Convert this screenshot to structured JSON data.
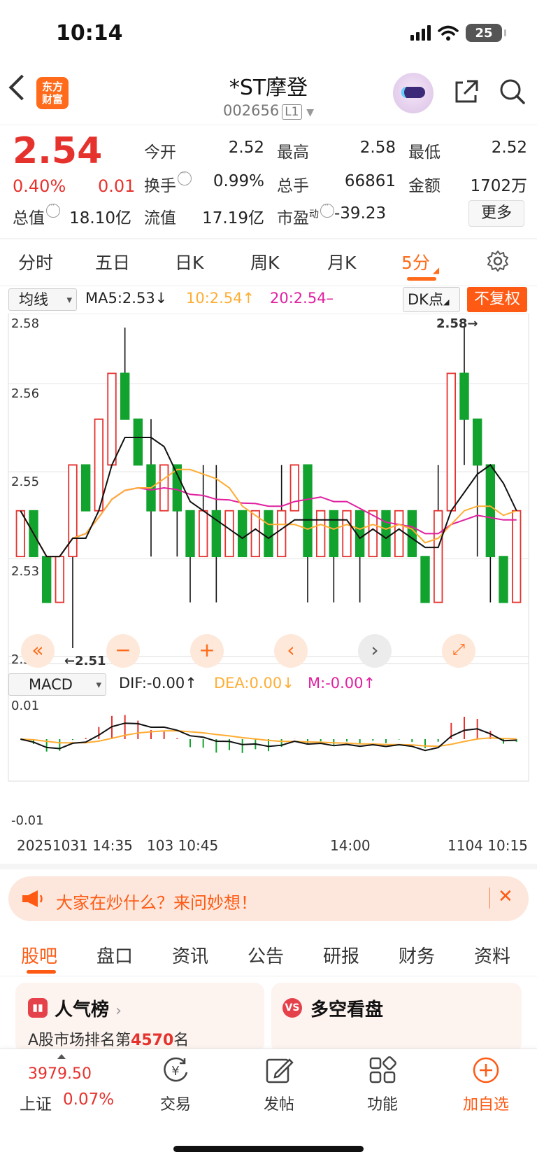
{
  "status": {
    "time": "10:14",
    "battery": "25"
  },
  "header": {
    "logo_line1": "东方",
    "logo_line2": "财富",
    "title": "*ST摩登",
    "code": "002656",
    "level": "L1"
  },
  "quote": {
    "price": "2.54",
    "pct": "0.40%",
    "chg": "0.01",
    "open_label": "今开",
    "open": "2.52",
    "high_label": "最高",
    "high": "2.58",
    "low_label": "最低",
    "low": "2.52",
    "turnover_label": "换手",
    "turnover": "0.99%",
    "volume_label": "总手",
    "volume": "66861",
    "amount_label": "金额",
    "amount": "1702万",
    "mktcap_label": "总值",
    "mktcap": "18.10亿",
    "float_label": "流值",
    "float": "17.19亿",
    "pe_label": "市盈",
    "pe_sup": "动",
    "pe": "-39.23",
    "more_label": "更多"
  },
  "period_tabs": [
    "分时",
    "五日",
    "日K",
    "周K",
    "月K",
    "5分"
  ],
  "active_period": "5分",
  "kline": {
    "indicator_select": "均线",
    "ma5": "MA5:2.53↓",
    "ma10": "10:2.54↑",
    "ma20": "20:2.54–",
    "dk_label": "DK点",
    "adjust_label": "不复权",
    "y_labels": [
      "2.58",
      "2.56",
      "2.55",
      "2.53",
      "2.51"
    ],
    "max_marker": "2.58→",
    "min_marker": "←2.51"
  },
  "macd": {
    "select": "MACD",
    "dif": "DIF:-0.00↑",
    "dea": "DEA:0.00↓",
    "m": "M:-0.00↑",
    "y_top": "0.01",
    "y_bottom": "-0.01"
  },
  "time_axis": [
    "20251031 14:35",
    "103 10:45",
    "14:00",
    "1104 10:15"
  ],
  "banner": {
    "text": "大家在炒什么？来问妙想！",
    "close": "✕"
  },
  "bottom_tabs": [
    "股吧",
    "盘口",
    "资讯",
    "公告",
    "研报",
    "财务",
    "资料"
  ],
  "active_bottom_tab": "股吧",
  "cards": {
    "popularity_title": "人气榜",
    "popularity_prefix": "A股市场排名第",
    "popularity_rank": "4570",
    "popularity_suffix": "名",
    "vs_title": "多空看盘"
  },
  "index_bar": {
    "value": "3979.50",
    "name": "上证",
    "change": "0.07%"
  },
  "nav": [
    "交易",
    "发帖",
    "功能",
    "加自选"
  ],
  "colors": {
    "up": "#e5322d",
    "down": "#12a22e",
    "accent": "#ff5a14",
    "ma5": "#111111",
    "ma10": "#ffad33",
    "ma20": "#e020a0"
  },
  "chart_data": {
    "type": "candlestick",
    "ylim": [
      2.51,
      2.58
    ],
    "series": [
      {
        "name": "5分K",
        "values": [
          [
            2.53,
            2.54,
            2.53,
            2.54
          ],
          [
            2.54,
            2.53,
            2.53,
            2.54
          ],
          [
            2.53,
            2.52,
            2.52,
            2.53
          ],
          [
            2.52,
            2.53,
            2.52,
            2.53
          ],
          [
            2.53,
            2.55,
            2.51,
            2.55
          ],
          [
            2.55,
            2.54,
            2.54,
            2.55
          ],
          [
            2.54,
            2.56,
            2.54,
            2.56
          ],
          [
            2.55,
            2.57,
            2.55,
            2.57
          ],
          [
            2.57,
            2.56,
            2.56,
            2.58
          ],
          [
            2.56,
            2.55,
            2.55,
            2.56
          ],
          [
            2.55,
            2.54,
            2.53,
            2.56
          ],
          [
            2.54,
            2.55,
            2.54,
            2.55
          ],
          [
            2.55,
            2.54,
            2.53,
            2.55
          ],
          [
            2.54,
            2.53,
            2.52,
            2.54
          ],
          [
            2.53,
            2.54,
            2.53,
            2.55
          ],
          [
            2.54,
            2.53,
            2.52,
            2.55
          ],
          [
            2.53,
            2.54,
            2.53,
            2.54
          ],
          [
            2.54,
            2.53,
            2.53,
            2.54
          ],
          [
            2.53,
            2.54,
            2.53,
            2.54
          ],
          [
            2.54,
            2.53,
            2.53,
            2.54
          ],
          [
            2.53,
            2.54,
            2.53,
            2.55
          ],
          [
            2.54,
            2.55,
            2.54,
            2.55
          ],
          [
            2.55,
            2.53,
            2.52,
            2.55
          ],
          [
            2.53,
            2.54,
            2.53,
            2.54
          ],
          [
            2.54,
            2.53,
            2.52,
            2.54
          ],
          [
            2.53,
            2.54,
            2.53,
            2.54
          ],
          [
            2.54,
            2.53,
            2.52,
            2.54
          ],
          [
            2.53,
            2.54,
            2.53,
            2.54
          ],
          [
            2.54,
            2.53,
            2.53,
            2.54
          ],
          [
            2.53,
            2.54,
            2.53,
            2.54
          ],
          [
            2.54,
            2.53,
            2.53,
            2.54
          ],
          [
            2.53,
            2.52,
            2.52,
            2.53
          ],
          [
            2.52,
            2.54,
            2.52,
            2.55
          ],
          [
            2.54,
            2.57,
            2.54,
            2.57
          ],
          [
            2.57,
            2.56,
            2.55,
            2.58
          ],
          [
            2.56,
            2.55,
            2.53,
            2.56
          ],
          [
            2.55,
            2.53,
            2.52,
            2.55
          ],
          [
            2.53,
            2.52,
            2.52,
            2.53
          ],
          [
            2.52,
            2.54,
            2.52,
            2.54
          ]
        ]
      }
    ]
  }
}
